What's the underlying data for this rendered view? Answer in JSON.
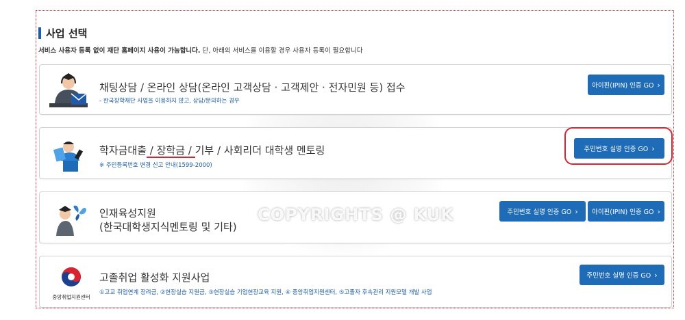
{
  "section": {
    "title": "사업 선택",
    "desc_bold": "서비스 사용자 등록 없이 재단 홈페이지 사용이 가능합니다.",
    "desc_rest": " 단, 아래의 서비스를 이용할 경우 사용자 등록이 필요합니다"
  },
  "cards": [
    {
      "heading": "채팅상담 / 온라인 상담(온라인 고객상담 · 고객제안 · 전자민원 등) 접수",
      "sub": "- 한국장학재단 사업을 이용하지 않고, 상담/문의하는 경우",
      "buttons": [
        "아이핀(IPIN) 인증 GO"
      ]
    },
    {
      "heading_parts": [
        "학자금대출",
        " / ",
        "장학금",
        " / ",
        "기부 / 사회리더 대학생 멘토링"
      ],
      "sub": "※ 주민등록번호 변경 신고 안내(1599-2000)",
      "buttons": [
        "주민번호 실명 인증 GO"
      ]
    },
    {
      "heading_line1": "인재육성지원",
      "heading_line2": "(한국대학생지식멘토링 및 기타)",
      "buttons": [
        "주민번호 실명 인증 GO",
        "아이핀(IPIN) 인증 GO"
      ]
    },
    {
      "heading": "고졸취업 활성화 지원사업",
      "sub": "①고교 취업연계 장려금, ②현장실습 지원금, ③현장실습 기업현장교육 지원, ④ 중앙취업지원센터, ⑤고졸자 후속관리 지원모델 개발 사업",
      "logo_label": "중앙취업지원센터",
      "buttons": [
        "주민번호 실명 인증 GO"
      ]
    }
  ],
  "chevron": "›",
  "watermark": "COPYRIGHTS @ KUK",
  "colors": {
    "accent": "#1e6bb8",
    "highlight": "#d9232e",
    "sub_text": "#1a5db3"
  }
}
